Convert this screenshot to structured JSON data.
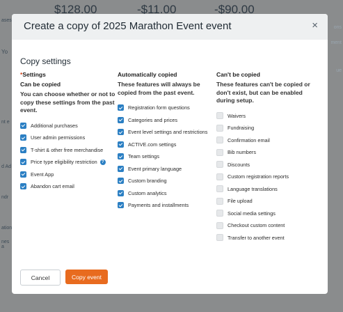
{
  "background": {
    "amounts": [
      "$128.00",
      "-$11.00",
      "-$90.00"
    ],
    "left_fragments": [
      "ases",
      "Yo",
      "nt e",
      "d Ad",
      "ndr",
      "ation",
      "nes a"
    ],
    "right_fragments": [
      "ons",
      "ment",
      "ue"
    ]
  },
  "modal": {
    "title": "Create a copy of 2025 Marathon Event event",
    "close_label": "×",
    "section_title": "Copy settings",
    "columns": {
      "settings": {
        "star": "*",
        "heading": "Settings",
        "subheading": "Can be copied",
        "description": "You can choose whether or not to copy these settings from the past event.",
        "items": [
          {
            "label": "Additional purchases"
          },
          {
            "label": "User admin permissions"
          },
          {
            "label": "T-shirt & other free merchandise"
          },
          {
            "label": "Price type eligibility restriction",
            "help": "?"
          },
          {
            "label": "Event App"
          },
          {
            "label": "Abandon cart email"
          }
        ]
      },
      "auto": {
        "heading": "Automatically copied",
        "description": "These features will always be copied from the past event.",
        "items": [
          {
            "label": "Registration form questions"
          },
          {
            "label": "Categories and prices"
          },
          {
            "label": "Event level settings and restrictions"
          },
          {
            "label": "ACTIVE.com settings"
          },
          {
            "label": "Team settings"
          },
          {
            "label": "Event primary language"
          },
          {
            "label": "Custom branding"
          },
          {
            "label": "Custom analytics"
          },
          {
            "label": "Payments and installments"
          }
        ]
      },
      "not_copied": {
        "heading": "Can't be copied",
        "description": "These features can't be copied or don't exist, but can be enabled during setup.",
        "items": [
          {
            "label": "Waivers"
          },
          {
            "label": "Fundraising"
          },
          {
            "label": "Confirmation email"
          },
          {
            "label": "Bib numbers"
          },
          {
            "label": "Discounts"
          },
          {
            "label": "Custom registration reports"
          },
          {
            "label": "Language translations"
          },
          {
            "label": "File upload"
          },
          {
            "label": "Social media settings"
          },
          {
            "label": "Checkout custom content"
          },
          {
            "label": "Transfer to another event"
          }
        ]
      }
    },
    "buttons": {
      "cancel": "Cancel",
      "copy": "Copy event"
    }
  },
  "colors": {
    "accent": "#2b7fc3",
    "primary_button": "#e86b1f",
    "overlay": "#8a8c8d"
  }
}
